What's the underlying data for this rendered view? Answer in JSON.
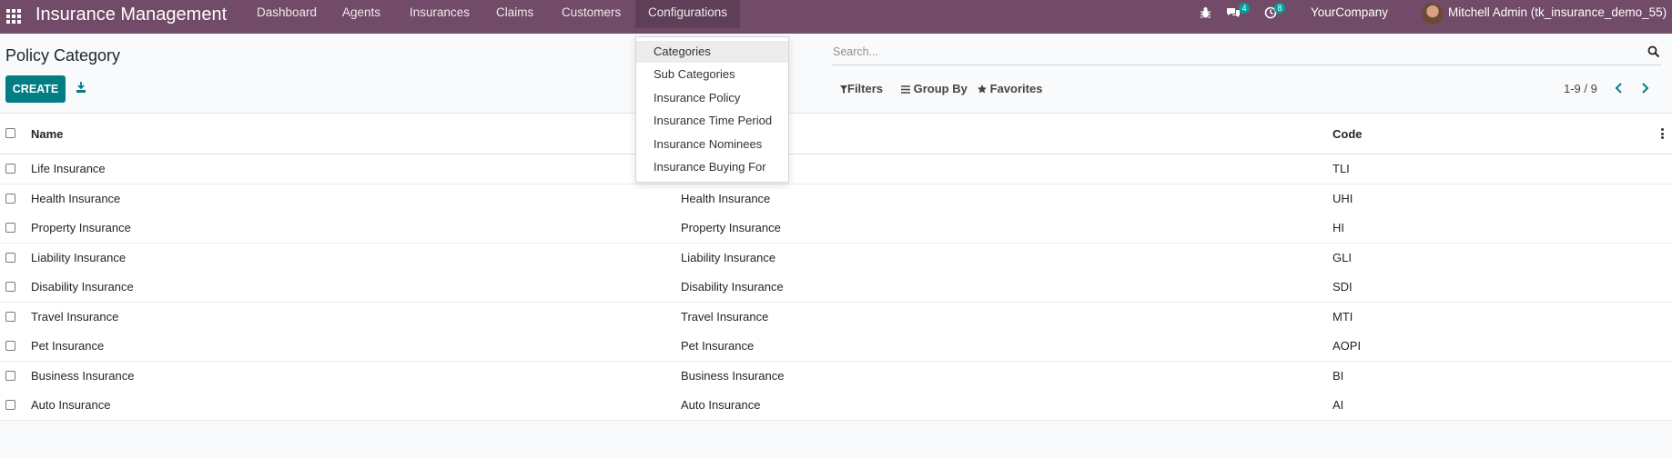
{
  "navbar": {
    "app_title": "Insurance Management",
    "menus": [
      "Dashboard",
      "Agents",
      "Insurances",
      "Claims",
      "Customers",
      "Configurations"
    ],
    "messages_badge": "4",
    "activities_badge": "8",
    "company": "YourCompany",
    "user": "Mitchell Admin (tk_insurance_demo_55)"
  },
  "page": {
    "title": "Policy Category",
    "create_label": "CREATE",
    "search_placeholder": "Search...",
    "filters_label": "Filters",
    "groupby_label": "Group By",
    "favorites_label": "Favorites",
    "pager": "1-9 / 9"
  },
  "table": {
    "columns": [
      "Name",
      "",
      "Code"
    ],
    "rows": [
      {
        "name": "Life Insurance",
        "category": "",
        "code": "TLI"
      },
      {
        "name": "Health Insurance",
        "category": "Health Insurance",
        "code": "UHI"
      },
      {
        "name": "Property Insurance",
        "category": "Property Insurance",
        "code": "HI"
      },
      {
        "name": "Liability Insurance",
        "category": "Liability Insurance",
        "code": "GLI"
      },
      {
        "name": "Disability Insurance",
        "category": "Disability Insurance",
        "code": "SDI"
      },
      {
        "name": "Travel Insurance",
        "category": "Travel Insurance",
        "code": "MTI"
      },
      {
        "name": "Pet Insurance",
        "category": "Pet Insurance",
        "code": "AOPI"
      },
      {
        "name": "Business Insurance",
        "category": "Business Insurance",
        "code": "BI"
      },
      {
        "name": "Auto Insurance",
        "category": "Auto Insurance",
        "code": "AI"
      }
    ]
  },
  "dropdown": {
    "items": [
      "Categories",
      "Sub Categories",
      "Insurance Policy",
      "Insurance Time Period",
      "Insurance Nominees",
      "Insurance Buying For"
    ],
    "highlighted": "Categories"
  },
  "colors": {
    "navbar": "#714b67",
    "primary_button": "#017e84",
    "badge": "#00a09d"
  }
}
